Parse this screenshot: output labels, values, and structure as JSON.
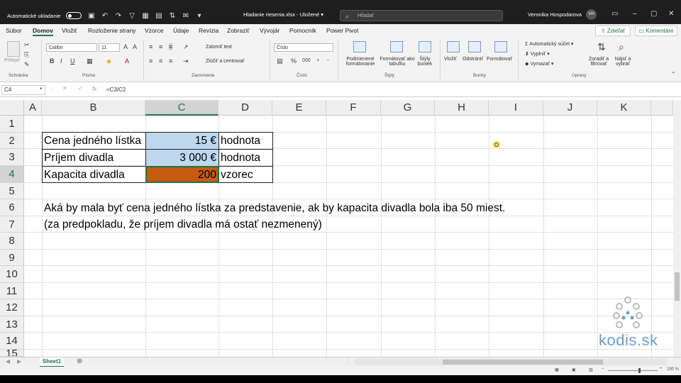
{
  "titlebar": {
    "autosave": "Automatické ukladanie",
    "filename": "Hladanie riesenia.xlsx",
    "saved": "Uložené",
    "search_placeholder": "Hľadať",
    "user": "Veronika Hospodarova",
    "initials": "VH"
  },
  "menu": {
    "tabs": [
      "Súbor",
      "Domov",
      "Vložiť",
      "Rozloženie strany",
      "Vzorce",
      "Údaje",
      "Revízia",
      "Zobraziť",
      "Vývojár",
      "Pomocník",
      "Power Pivot"
    ],
    "share": "Zdieľať",
    "comments": "Komentáre"
  },
  "ribbon": {
    "paste": "Prilepiť",
    "clipboard": "Schránka",
    "font_name": "Calibri",
    "font_size": "11",
    "font_group": "Písmo",
    "wrap": "Zalomiť text",
    "merge": "Zlúčiť a centrovať",
    "align_group": "Zarovnanie",
    "number_format": "Číslo",
    "number_group": "Číslo",
    "cond_format": "Podmienené formátovanie",
    "format_table": "Formátovať ako tabuľku",
    "styles": "Štýly buniek",
    "styles_group": "Štýly",
    "insert": "Vložiť",
    "delete": "Odstrániť",
    "format": "Formátovať",
    "cells_group": "Bunky",
    "autosum": "Automatický súčet",
    "fill": "Vyplniť",
    "clear": "Vymazať",
    "sort": "Zoradiť a filtrovať",
    "find": "Nájsť a vybrať",
    "edit_group": "Úpravy"
  },
  "formula_bar": {
    "name_box": "C4",
    "formula": "=C3/C2"
  },
  "columns": [
    "A",
    "B",
    "C",
    "D",
    "E",
    "F",
    "G",
    "H",
    "I",
    "J",
    "K"
  ],
  "rows": [
    "1",
    "2",
    "3",
    "4",
    "5",
    "6",
    "7",
    "8",
    "9",
    "10",
    "11",
    "12",
    "13",
    "14",
    "15"
  ],
  "cells": {
    "B2": "Cena jedného lístka",
    "C2": "15 €",
    "D2": "hodnota",
    "B3": "Príjem divadla",
    "C3": "3 000 €",
    "D3": "hodnota",
    "B4": "Kapacita divadla",
    "C4": "200",
    "D4": "vzorec",
    "B6": "Aká by mala byť cena jedného lístka za predstavenie, ak by kapacita divadla bola iba 50 miest.",
    "B7": "(za predpokladu, že príjem divadla má ostať nezmenený)"
  },
  "sheet_tab": "Sheet1",
  "zoom": "190 %",
  "watermark": "kodis.sk",
  "colors": {
    "accent": "#217346",
    "input_fill": "#bdd7ee",
    "formula_fill": "#c55a11"
  }
}
